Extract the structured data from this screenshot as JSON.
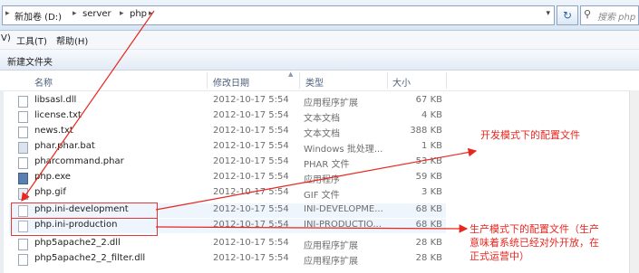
{
  "address": {
    "crumbs": [
      "新加卷 (D:)",
      "server",
      "php"
    ],
    "refresh_icon": "refresh-icon",
    "search_placeholder": "搜索 php"
  },
  "menu": [
    "V)",
    "工具(T)",
    "帮助(H)"
  ],
  "toolbar": {
    "new_folder": "新建文件夹"
  },
  "columns": {
    "name": "名称",
    "date": "修改日期",
    "type": "类型",
    "size": "大小"
  },
  "files": [
    {
      "name": "libsasl.dll",
      "date": "2012-10-17 5:54",
      "type": "应用程序扩展",
      "size": "67 KB",
      "icon": "file-icon"
    },
    {
      "name": "license.txt",
      "date": "2012-10-17 5:54",
      "type": "文本文档",
      "size": "4 KB",
      "icon": "file-icon"
    },
    {
      "name": "news.txt",
      "date": "2012-10-17 5:54",
      "type": "文本文档",
      "size": "388 KB",
      "icon": "file-icon"
    },
    {
      "name": "phar.phar.bat",
      "date": "2012-10-17 5:54",
      "type": "Windows 批处理...",
      "size": "1 KB",
      "icon": "bat-icon"
    },
    {
      "name": "pharcommand.phar",
      "date": "2012-10-17 5:54",
      "type": "PHAR 文件",
      "size": "53 KB",
      "icon": "file-icon"
    },
    {
      "name": "php.exe",
      "date": "2012-10-17 5:54",
      "type": "应用程序",
      "size": "59 KB",
      "icon": "exe-icon"
    },
    {
      "name": "php.gif",
      "date": "2012-10-17 5:54",
      "type": "GIF 文件",
      "size": "3 KB",
      "icon": "image-icon"
    },
    {
      "name": "php.ini-development",
      "date": "2012-10-17 5:54",
      "type": "INI-DEVELOPME...",
      "size": "68 KB",
      "icon": "file-icon"
    },
    {
      "name": "php.ini-production",
      "date": "2012-10-17 5:54",
      "type": "INI-PRODUCTIO...",
      "size": "68 KB",
      "icon": "file-icon"
    },
    {
      "name": "php5apache2_2.dll",
      "date": "2012-10-17 5:54",
      "type": "应用程序扩展",
      "size": "28 KB",
      "icon": "file-icon"
    },
    {
      "name": "php5apache2_2_filter.dll",
      "date": "2012-10-17 5:54",
      "type": "应用程序扩展",
      "size": "28 KB",
      "icon": "file-icon"
    }
  ],
  "annotations": {
    "dev": "开发模式下的配置文件",
    "prod_line1": "生产模式下的配置文件（生产",
    "prod_line2": "意味着系统已经对外开放，在",
    "prod_line3": "正式运营中）"
  },
  "colors": {
    "annotation": "#e8261f",
    "highlight_row": "#eef5fd"
  }
}
